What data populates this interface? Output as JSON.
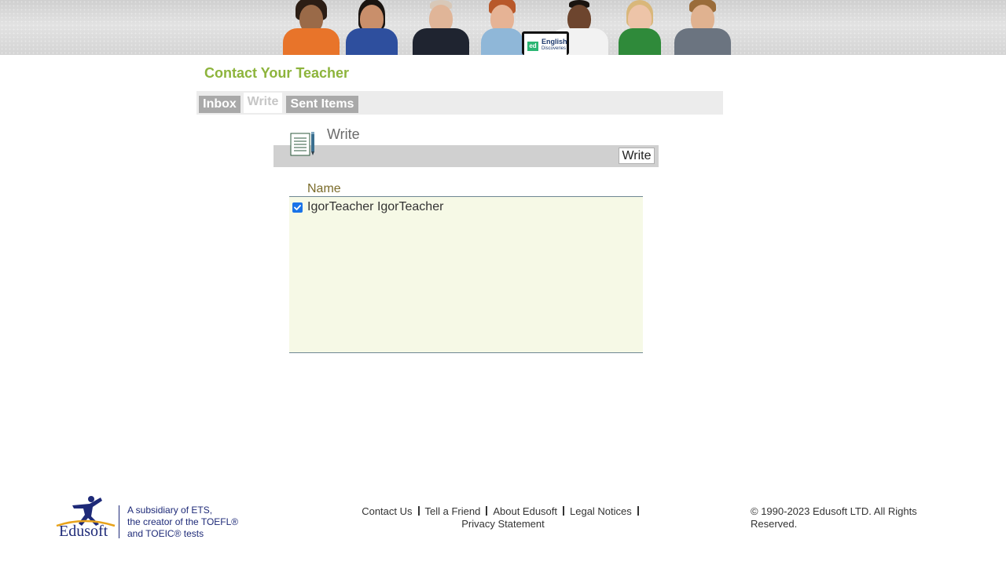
{
  "header": {
    "banner_alt": "English Discoveries",
    "tablet_badge": "ed",
    "tablet_title": "English",
    "tablet_subtitle": "Discoveries"
  },
  "page": {
    "title": "Contact Your Teacher"
  },
  "tabs": [
    {
      "label": "Inbox",
      "active": false
    },
    {
      "label": "Write",
      "active": true
    },
    {
      "label": "Sent Items",
      "active": false
    }
  ],
  "write": {
    "heading": "Write",
    "button_label": "Write",
    "icon": "notepad-pen-icon"
  },
  "recipients": {
    "column_header": "Name",
    "rows": [
      {
        "name": "IgorTeacher IgorTeacher",
        "checked": true
      }
    ]
  },
  "footer": {
    "logo_name": "Edusoft",
    "logo_tagline_1": "A subsidiary of ETS,",
    "logo_tagline_2": "the creator of the TOEFL®",
    "logo_tagline_3": "and TOEIC® tests",
    "links": {
      "contact": "Contact Us",
      "tell": "Tell a Friend",
      "about": "About Edusoft",
      "legal": "Legal Notices",
      "privacy": "Privacy Statement"
    },
    "copyright": "© 1990-2023 Edusoft LTD. All Rights Reserved."
  },
  "colors": {
    "title_green": "#8db43c",
    "tab_gray": "#a9a9a9",
    "list_bg": "#f6f9e6",
    "brand_navy": "#1e2a78",
    "checkbox_blue": "#1a73e8"
  }
}
